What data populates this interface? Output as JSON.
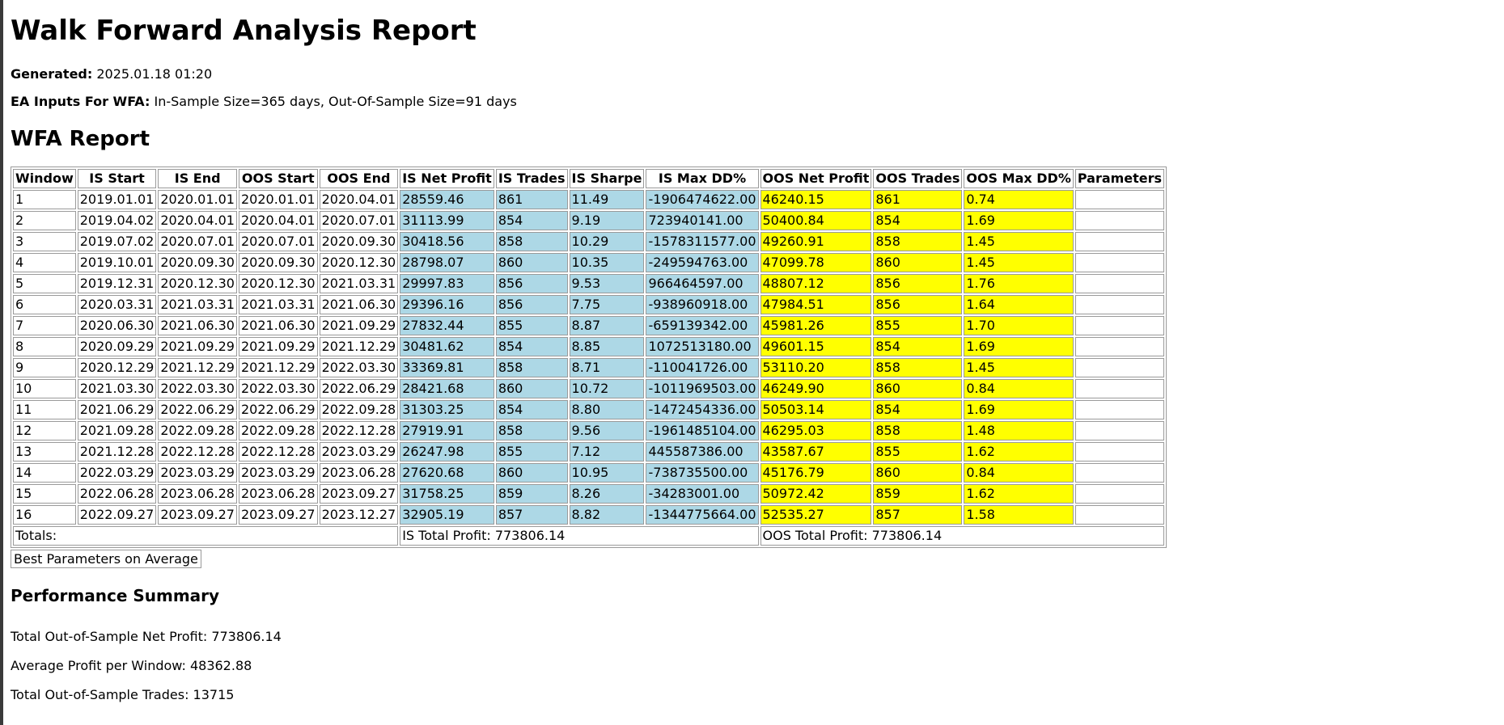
{
  "title": "Walk Forward Analysis Report",
  "generated_label": "Generated:",
  "generated_value": "2025.01.18 01:20",
  "inputs_label": "EA Inputs For WFA:",
  "inputs_value": "In-Sample Size=365 days, Out-Of-Sample Size=91 days",
  "report_heading": "WFA Report",
  "columns": [
    "Window",
    "IS Start",
    "IS End",
    "OOS Start",
    "OOS End",
    "IS Net Profit",
    "IS Trades",
    "IS Sharpe",
    "IS Max DD%",
    "OOS Net Profit",
    "OOS Trades",
    "OOS Max DD%",
    "Parameters"
  ],
  "rows": [
    [
      "1",
      "2019.01.01",
      "2020.01.01",
      "2020.01.01",
      "2020.04.01",
      "28559.46",
      "861",
      "11.49",
      "-1906474622.00",
      "46240.15",
      "861",
      "0.74",
      ""
    ],
    [
      "2",
      "2019.04.02",
      "2020.04.01",
      "2020.04.01",
      "2020.07.01",
      "31113.99",
      "854",
      "9.19",
      "723940141.00",
      "50400.84",
      "854",
      "1.69",
      ""
    ],
    [
      "3",
      "2019.07.02",
      "2020.07.01",
      "2020.07.01",
      "2020.09.30",
      "30418.56",
      "858",
      "10.29",
      "-1578311577.00",
      "49260.91",
      "858",
      "1.45",
      ""
    ],
    [
      "4",
      "2019.10.01",
      "2020.09.30",
      "2020.09.30",
      "2020.12.30",
      "28798.07",
      "860",
      "10.35",
      "-249594763.00",
      "47099.78",
      "860",
      "1.45",
      ""
    ],
    [
      "5",
      "2019.12.31",
      "2020.12.30",
      "2020.12.30",
      "2021.03.31",
      "29997.83",
      "856",
      "9.53",
      "966464597.00",
      "48807.12",
      "856",
      "1.76",
      ""
    ],
    [
      "6",
      "2020.03.31",
      "2021.03.31",
      "2021.03.31",
      "2021.06.30",
      "29396.16",
      "856",
      "7.75",
      "-938960918.00",
      "47984.51",
      "856",
      "1.64",
      ""
    ],
    [
      "7",
      "2020.06.30",
      "2021.06.30",
      "2021.06.30",
      "2021.09.29",
      "27832.44",
      "855",
      "8.87",
      "-659139342.00",
      "45981.26",
      "855",
      "1.70",
      ""
    ],
    [
      "8",
      "2020.09.29",
      "2021.09.29",
      "2021.09.29",
      "2021.12.29",
      "30481.62",
      "854",
      "8.85",
      "1072513180.00",
      "49601.15",
      "854",
      "1.69",
      ""
    ],
    [
      "9",
      "2020.12.29",
      "2021.12.29",
      "2021.12.29",
      "2022.03.30",
      "33369.81",
      "858",
      "8.71",
      "-110041726.00",
      "53110.20",
      "858",
      "1.45",
      ""
    ],
    [
      "10",
      "2021.03.30",
      "2022.03.30",
      "2022.03.30",
      "2022.06.29",
      "28421.68",
      "860",
      "10.72",
      "-1011969503.00",
      "46249.90",
      "860",
      "0.84",
      ""
    ],
    [
      "11",
      "2021.06.29",
      "2022.06.29",
      "2022.06.29",
      "2022.09.28",
      "31303.25",
      "854",
      "8.80",
      "-1472454336.00",
      "50503.14",
      "854",
      "1.69",
      ""
    ],
    [
      "12",
      "2021.09.28",
      "2022.09.28",
      "2022.09.28",
      "2022.12.28",
      "27919.91",
      "858",
      "9.56",
      "-1961485104.00",
      "46295.03",
      "858",
      "1.48",
      ""
    ],
    [
      "13",
      "2021.12.28",
      "2022.12.28",
      "2022.12.28",
      "2023.03.29",
      "26247.98",
      "855",
      "7.12",
      "445587386.00",
      "43587.67",
      "855",
      "1.62",
      ""
    ],
    [
      "14",
      "2022.03.29",
      "2023.03.29",
      "2023.03.29",
      "2023.06.28",
      "27620.68",
      "860",
      "10.95",
      "-738735500.00",
      "45176.79",
      "860",
      "0.84",
      ""
    ],
    [
      "15",
      "2022.06.28",
      "2023.06.28",
      "2023.06.28",
      "2023.09.27",
      "31758.25",
      "859",
      "8.26",
      "-34283001.00",
      "50972.42",
      "859",
      "1.62",
      ""
    ],
    [
      "16",
      "2022.09.27",
      "2023.09.27",
      "2023.09.27",
      "2023.12.27",
      "32905.19",
      "857",
      "8.82",
      "-1344775664.00",
      "52535.27",
      "857",
      "1.58",
      ""
    ]
  ],
  "totals": {
    "label": "Totals:",
    "is_total": "IS Total Profit: 773806.14",
    "oos_total": "OOS Total Profit: 773806.14"
  },
  "best_params_label": "Best Parameters on Average",
  "summary": {
    "heading": "Performance Summary",
    "total_oos_profit": "Total Out-of-Sample Net Profit: 773806.14",
    "avg_profit": "Average Profit per Window: 48362.88",
    "total_oos_trades": "Total Out-of-Sample Trades: 13715"
  },
  "colors": {
    "is_fill": "#add8e6",
    "oos_fill": "#ffff00"
  }
}
